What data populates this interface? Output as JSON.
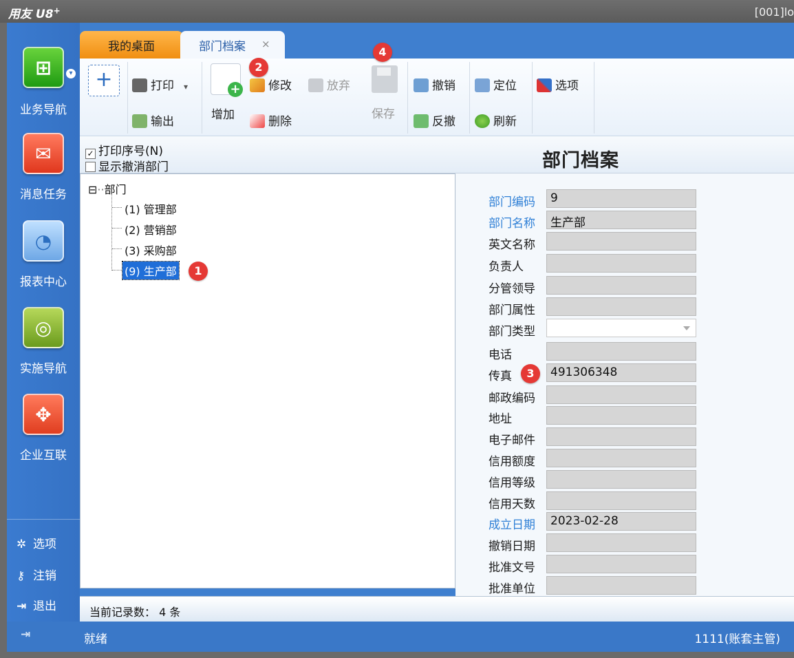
{
  "app": {
    "brand": "用友 U8",
    "brand_sup": "+",
    "account": "[001]lo"
  },
  "sidebar": {
    "items": [
      {
        "label": "业务导航",
        "icon": "business-nav-icon"
      },
      {
        "label": "消息任务",
        "icon": "message-task-icon"
      },
      {
        "label": "报表中心",
        "icon": "report-center-icon"
      },
      {
        "label": "实施导航",
        "icon": "implementation-nav-icon"
      },
      {
        "label": "企业互联",
        "icon": "enterprise-connect-icon"
      }
    ],
    "links": [
      {
        "label": "选项",
        "icon": "gear-icon"
      },
      {
        "label": "注销",
        "icon": "key-icon"
      },
      {
        "label": "退出",
        "icon": "exit-icon"
      }
    ]
  },
  "tabs": [
    {
      "label": "我的桌面"
    },
    {
      "label": "部门档案",
      "close": "×"
    }
  ],
  "toolbar": {
    "add_plus": "+",
    "print": "打印",
    "export": "输出",
    "add": "增加",
    "modify": "修改",
    "abandon": "放弃",
    "delete": "删除",
    "save": "保存",
    "revoke": "撤销",
    "unrevoke": "反撤",
    "locate": "定位",
    "refresh": "刷新",
    "options": "选项"
  },
  "subhead": {
    "print_seq_label": "打印序号(N)",
    "print_seq_checked": true,
    "show_revoked_label": "显示撤消部门",
    "show_revoked_checked": false,
    "form_title": "部门档案"
  },
  "tree": {
    "root": "部门",
    "root_toggle": "⊟",
    "nodes": [
      {
        "label": "(1) 管理部"
      },
      {
        "label": "(2) 营销部"
      },
      {
        "label": "(3) 采购部"
      },
      {
        "label": "(9) 生产部",
        "selected": true
      }
    ]
  },
  "form": {
    "fields": [
      {
        "label": "部门编码",
        "value": "9",
        "required": true
      },
      {
        "label": "部门名称",
        "value": "生产部",
        "required": true
      },
      {
        "label": "英文名称",
        "value": ""
      },
      {
        "label": "负责人",
        "value": ""
      },
      {
        "label": "分管领导",
        "value": ""
      },
      {
        "label": "部门属性",
        "value": ""
      },
      {
        "label": "部门类型",
        "value": "",
        "type": "combo"
      },
      {
        "label": "电话",
        "value": ""
      },
      {
        "label": "传真",
        "value": "491306348"
      },
      {
        "label": "邮政编码",
        "value": ""
      },
      {
        "label": "地址",
        "value": ""
      },
      {
        "label": "电子邮件",
        "value": ""
      },
      {
        "label": "信用额度",
        "value": ""
      },
      {
        "label": "信用等级",
        "value": ""
      },
      {
        "label": "信用天数",
        "value": ""
      },
      {
        "label": "成立日期",
        "value": "2023-02-28",
        "required": true
      },
      {
        "label": "撤销日期",
        "value": ""
      },
      {
        "label": "批准文号",
        "value": ""
      },
      {
        "label": "批准单位",
        "value": ""
      }
    ]
  },
  "record_bar": {
    "text": "当前记录数： 4 条"
  },
  "status": {
    "left": "就绪",
    "right": "1111(账套主管)"
  },
  "badges": [
    "1",
    "2",
    "3",
    "4"
  ],
  "colors": {
    "frame_blue": "#3f7fcf",
    "required_label": "#2e7fd6",
    "badge_red": "#e53935",
    "tab_orange": "#f08f12",
    "selection_blue": "#1f6ed8"
  }
}
